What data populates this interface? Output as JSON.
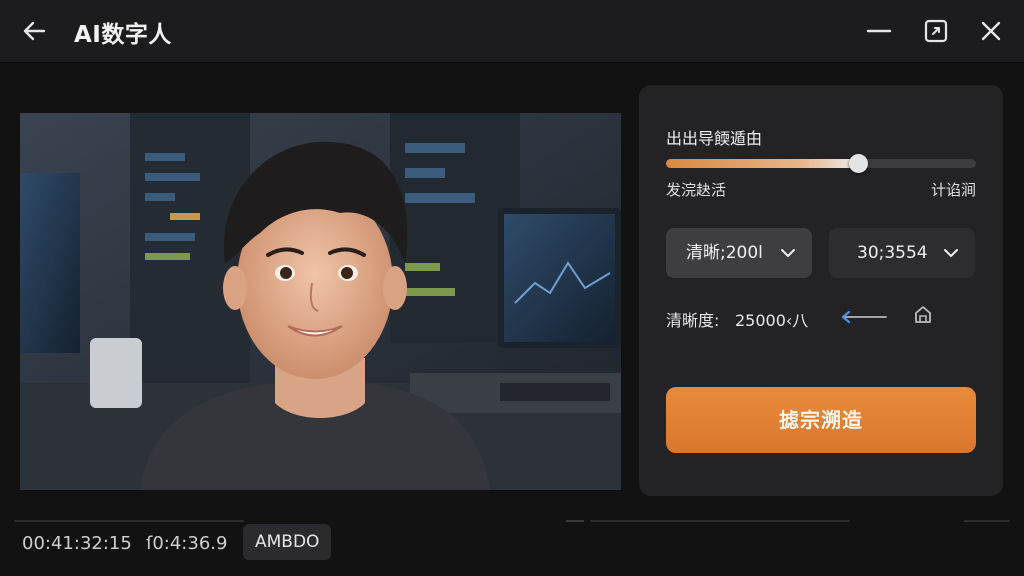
{
  "app": {
    "title": "AI数字人"
  },
  "settings": {
    "slider_label": "出出导餪遁甶",
    "slider_value": 0.62,
    "slider_min_label": "发浣赽活",
    "slider_max_label": "计谄涧",
    "resolution_dropdown": "清晰;200l",
    "fps_dropdown": "30;3554",
    "bitrate_label": "清晰度:",
    "bitrate_value": "25000‹八",
    "primary_button": "摅宗溯造"
  },
  "timeline": {
    "time_current": "00:41:32:15",
    "time_total": "ſ0:4:36.9",
    "tag": "AMBDO"
  },
  "colors": {
    "accent": "#E2843A",
    "panel": "#232326",
    "background": "#121212"
  },
  "icons": [
    "back-arrow-icon",
    "minimize-icon",
    "restore-icon",
    "close-icon",
    "chevron-down-icon",
    "arrow-left-icon",
    "export-icon"
  ]
}
